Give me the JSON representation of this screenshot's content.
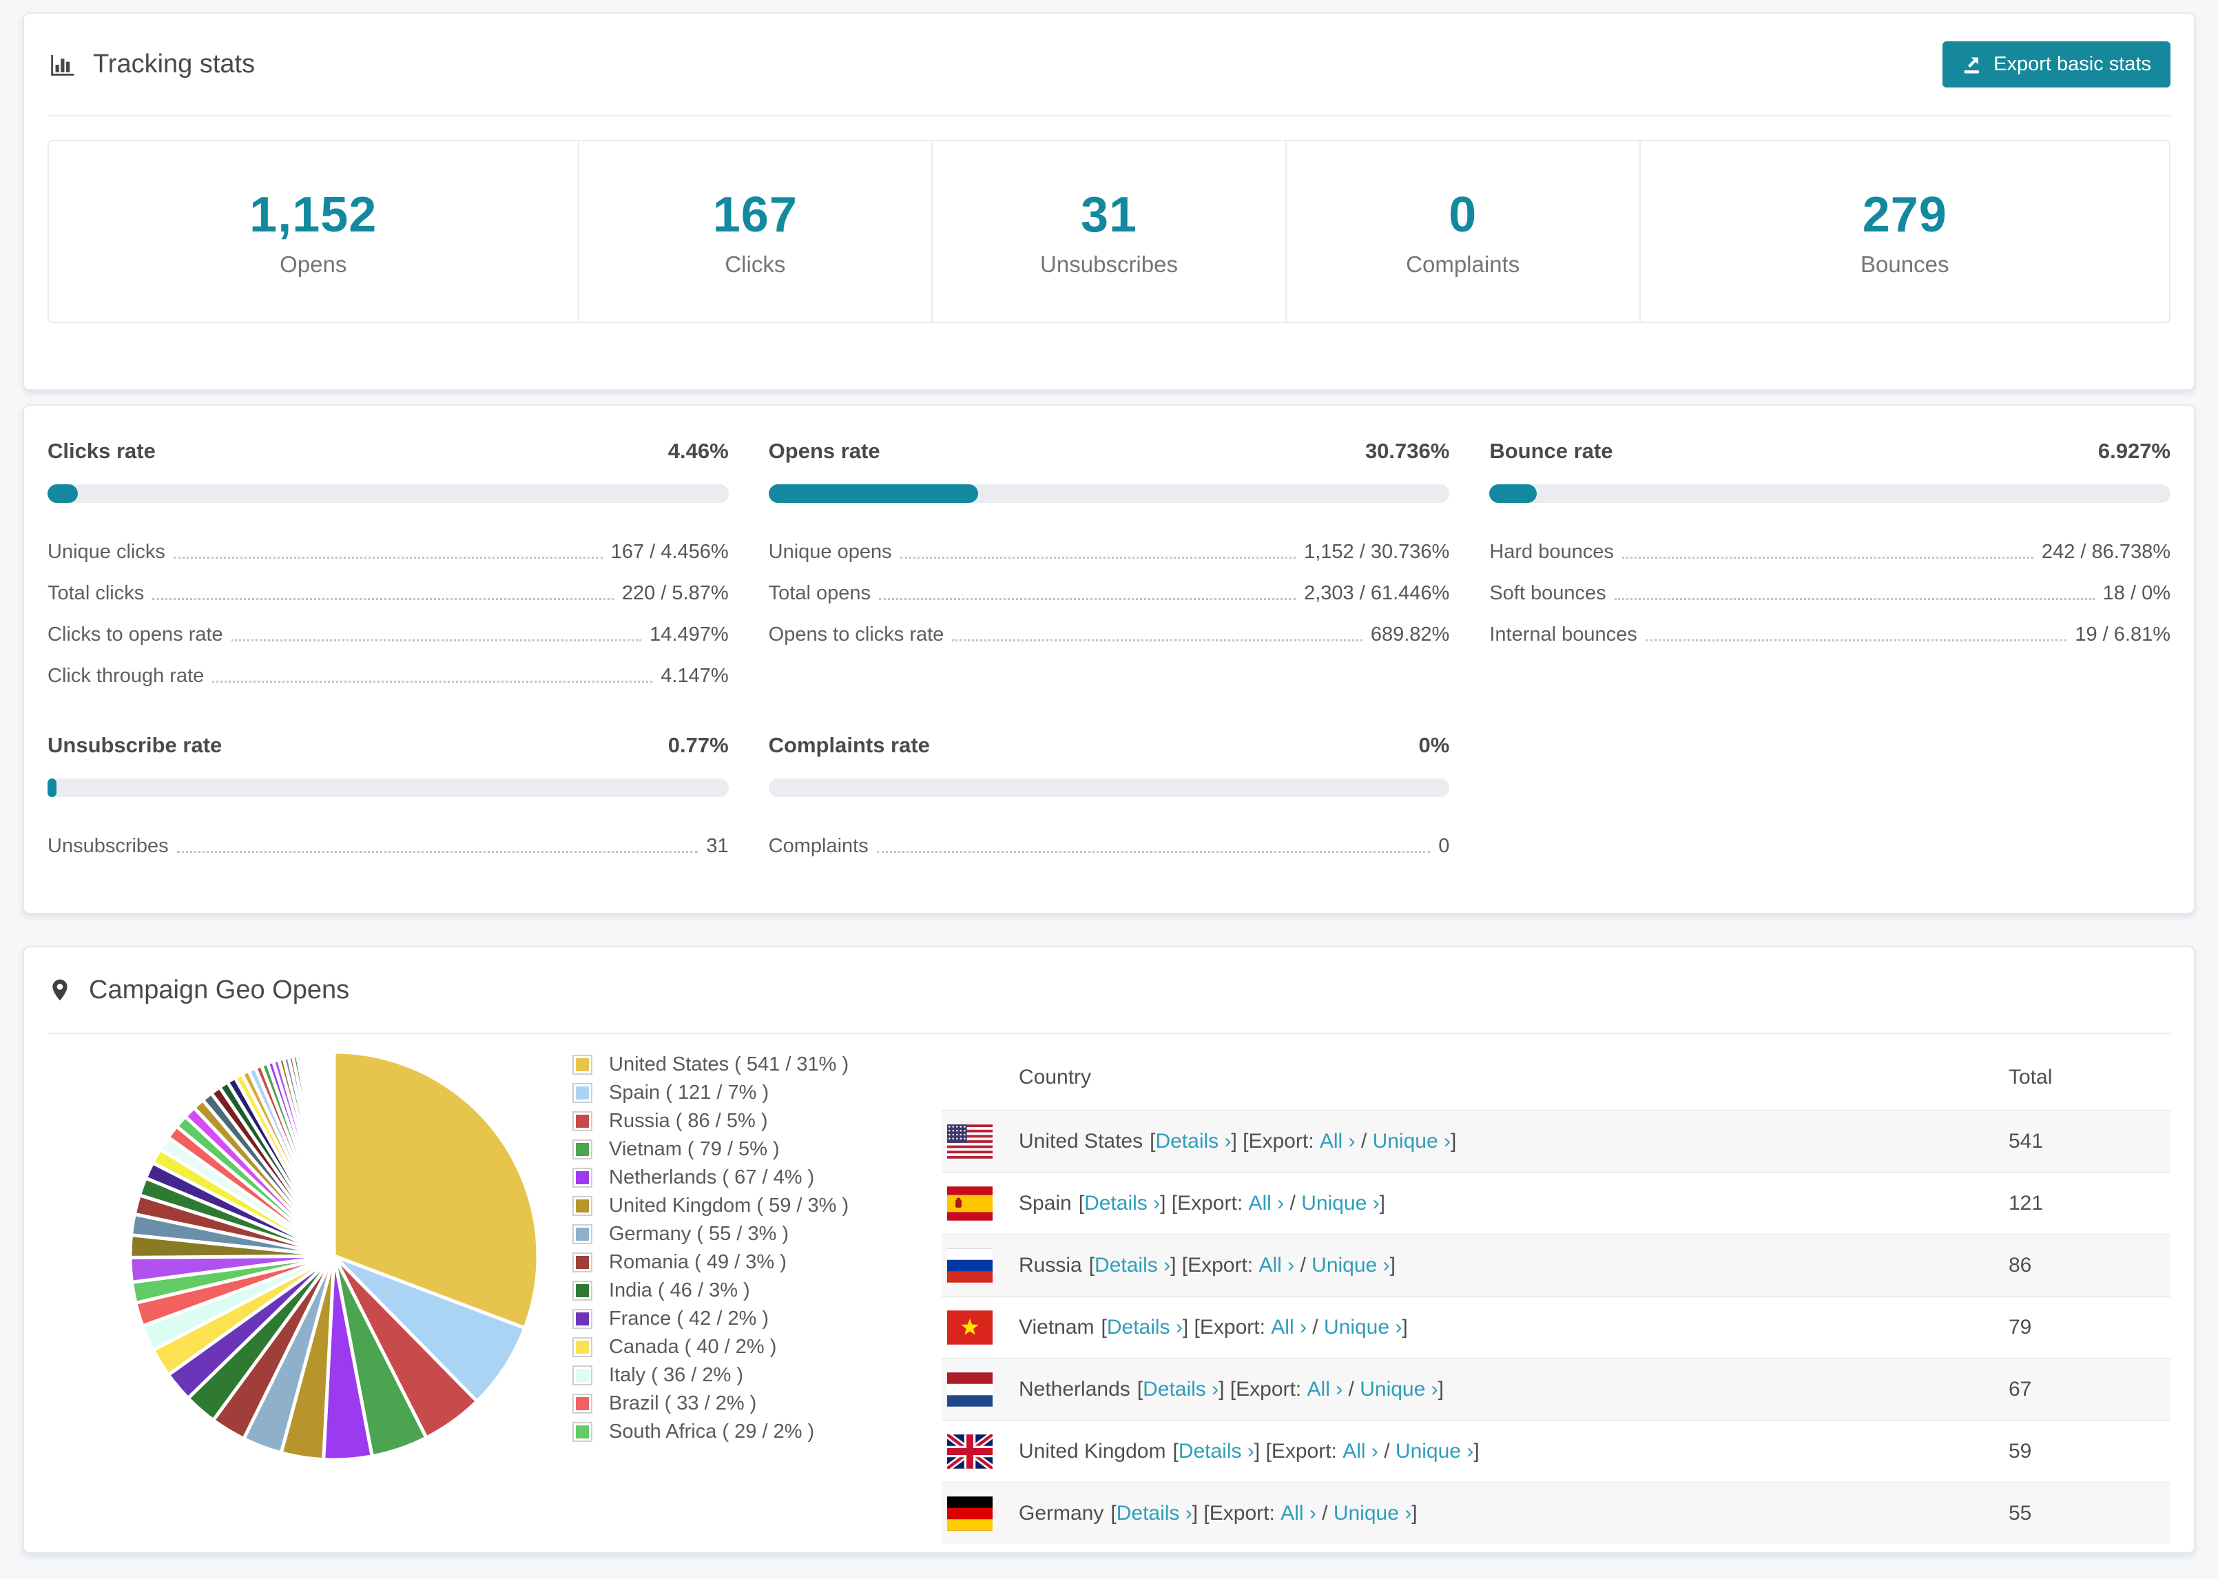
{
  "header": {
    "title": "Tracking stats",
    "export_button": "Export basic stats"
  },
  "summary_stats": [
    {
      "value": "1,152",
      "label": "Opens"
    },
    {
      "value": "167",
      "label": "Clicks"
    },
    {
      "value": "31",
      "label": "Unsubscribes"
    },
    {
      "value": "0",
      "label": "Complaints"
    },
    {
      "value": "279",
      "label": "Bounces"
    }
  ],
  "rate_blocks": [
    {
      "title": "Clicks rate",
      "percent": "4.46%",
      "bar_pct": 4.46,
      "rows": [
        {
          "label": "Unique clicks",
          "value": "167 / 4.456%"
        },
        {
          "label": "Total clicks",
          "value": "220 / 5.87%"
        },
        {
          "label": "Clicks to opens rate",
          "value": "14.497%"
        },
        {
          "label": "Click through rate",
          "value": "4.147%"
        }
      ]
    },
    {
      "title": "Opens rate",
      "percent": "30.736%",
      "bar_pct": 30.736,
      "rows": [
        {
          "label": "Unique opens",
          "value": "1,152 / 30.736%"
        },
        {
          "label": "Total opens",
          "value": "2,303 / 61.446%"
        },
        {
          "label": "Opens to clicks rate",
          "value": "689.82%"
        }
      ]
    },
    {
      "title": "Bounce rate",
      "percent": "6.927%",
      "bar_pct": 6.927,
      "rows": [
        {
          "label": "Hard bounces",
          "value": "242 / 86.738%"
        },
        {
          "label": "Soft bounces",
          "value": "18 / 0%"
        },
        {
          "label": "Internal bounces",
          "value": "19 / 6.81%"
        }
      ]
    },
    {
      "title": "Unsubscribe rate",
      "percent": "0.77%",
      "bar_pct": 0.77,
      "rows": [
        {
          "label": "Unsubscribes",
          "value": "31"
        }
      ]
    },
    {
      "title": "Complaints rate",
      "percent": "0%",
      "bar_pct": 0,
      "rows": [
        {
          "label": "Complaints",
          "value": "0"
        }
      ]
    }
  ],
  "geo": {
    "title": "Campaign Geo Opens",
    "table": {
      "col_country": "Country",
      "col_total": "Total",
      "details_label": "Details ›",
      "export_prefix": "Export:",
      "all_label": "All ›",
      "unique_label": "Unique ›",
      "rows": [
        {
          "country": "United States",
          "flag": "us",
          "total": "541"
        },
        {
          "country": "Spain",
          "flag": "es",
          "total": "121"
        },
        {
          "country": "Russia",
          "flag": "ru",
          "total": "86"
        },
        {
          "country": "Vietnam",
          "flag": "vn",
          "total": "79"
        },
        {
          "country": "Netherlands",
          "flag": "nl",
          "total": "67"
        },
        {
          "country": "United Kingdom",
          "flag": "gb",
          "total": "59"
        },
        {
          "country": "Germany",
          "flag": "de",
          "total": "55"
        }
      ]
    }
  },
  "chart_data": {
    "type": "pie",
    "title": "Campaign Geo Opens",
    "legend_position": "right",
    "slices": [
      {
        "label": "United States",
        "value": 541,
        "pct": "31%",
        "color": "#e7c44b"
      },
      {
        "label": "Spain",
        "value": 121,
        "pct": "7%",
        "color": "#abd3f3"
      },
      {
        "label": "Russia",
        "value": 86,
        "pct": "5%",
        "color": "#c84b4b"
      },
      {
        "label": "Vietnam",
        "value": 79,
        "pct": "5%",
        "color": "#4ba44f"
      },
      {
        "label": "Netherlands",
        "value": 67,
        "pct": "4%",
        "color": "#9c3af0"
      },
      {
        "label": "United Kingdom",
        "value": 59,
        "pct": "3%",
        "color": "#b8952c"
      },
      {
        "label": "Germany",
        "value": 55,
        "pct": "3%",
        "color": "#8fb0ca"
      },
      {
        "label": "Romania",
        "value": 49,
        "pct": "3%",
        "color": "#a03f39"
      },
      {
        "label": "India",
        "value": 46,
        "pct": "3%",
        "color": "#2f7a33"
      },
      {
        "label": "France",
        "value": 42,
        "pct": "2%",
        "color": "#6b35ba"
      },
      {
        "label": "Canada",
        "value": 40,
        "pct": "2%",
        "color": "#fce151"
      },
      {
        "label": "Italy",
        "value": 36,
        "pct": "2%",
        "color": "#dcfdf3"
      },
      {
        "label": "Brazil",
        "value": 33,
        "pct": "2%",
        "color": "#f2605f"
      },
      {
        "label": "South Africa",
        "value": 29,
        "pct": "2%",
        "color": "#63cb63"
      }
    ],
    "others": {
      "note": "remaining unlabeled countries (thin slices)",
      "values": [
        34,
        31,
        29,
        27,
        25,
        23,
        21,
        20,
        19,
        18,
        17,
        16,
        15,
        14,
        13,
        12,
        11,
        10,
        10,
        9,
        9,
        8,
        8,
        7,
        7,
        6,
        6,
        5,
        5,
        4,
        4,
        4,
        3,
        3,
        3,
        3,
        2,
        2,
        2,
        2,
        2,
        1,
        1,
        1,
        1,
        1,
        1,
        1
      ],
      "palette": [
        "#b052f0",
        "#8a7a24",
        "#6a8fa8",
        "#9e3d38",
        "#2f7a33",
        "#45268f",
        "#f5ef3d",
        "#e8fcf5",
        "#f2605f",
        "#5ecc64",
        "#d44df2",
        "#b8952c",
        "#4a6a7a",
        "#7a1f1f",
        "#1e5c2e",
        "#2a1e6e",
        "#ffe94d",
        "#d9a93a",
        "#abd3f3",
        "#c84b4b",
        "#4ba44f",
        "#9c3af0"
      ]
    }
  },
  "colors": {
    "accent_teal": "#12899e",
    "button_teal": "#15889c",
    "link_blue": "#2e9dbb",
    "bar_track": "#eaecf0"
  }
}
